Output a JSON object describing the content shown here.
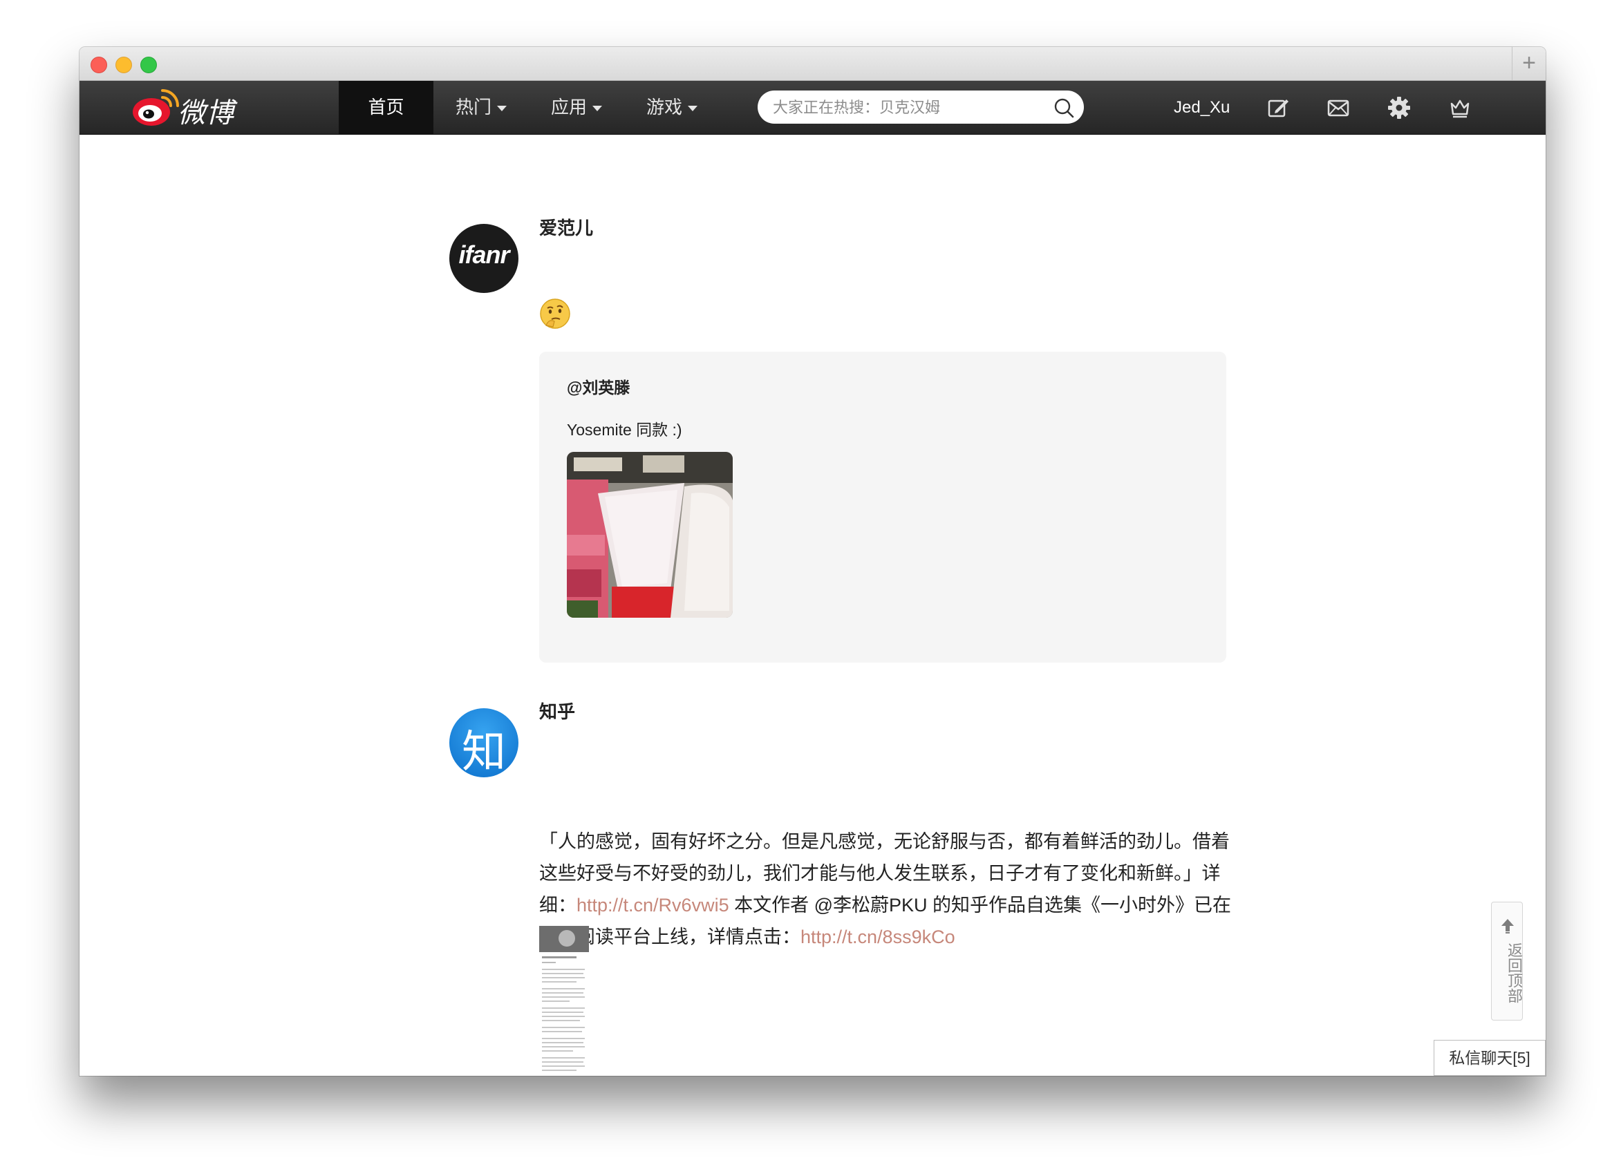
{
  "window": {
    "new_tab_icon": "plus-icon"
  },
  "navbar": {
    "logo_text": "微博",
    "items": [
      {
        "label": "首页",
        "active": true
      },
      {
        "label": "热门",
        "has_dropdown": true
      },
      {
        "label": "应用",
        "has_dropdown": true
      },
      {
        "label": "游戏",
        "has_dropdown": true
      }
    ],
    "search_placeholder": "大家正在热搜：贝克汉姆",
    "username": "Jed_Xu",
    "icons": [
      "compose-icon",
      "mail-icon",
      "gear-icon",
      "crown-icon"
    ]
  },
  "posts": [
    {
      "author": "爱范儿",
      "avatar_text": "ifanr",
      "emoji": "thinking-face-icon",
      "repost": {
        "user": "@刘英滕",
        "text": "Yosemite 同款 :)"
      }
    },
    {
      "author": "知乎",
      "avatar_text": "知",
      "text_parts": [
        "「人的感觉，固有好坏之分。但是凡感觉，无论舒服与否，都有着鲜活的劲儿。借着这些好受与不好受的劲儿，我们才能与他人发生联系，日子才有了变化和新鲜。」详细：",
        "http://t.cn/Rv6vwi5",
        " 本文作者 @李松蔚PKU 的知乎作品自选集《一小时外》已在各大阅读平台上线，详情点击：",
        "http://t.cn/8ss9kCo"
      ]
    }
  ],
  "back_to_top": "返回顶部",
  "chat_button": "私信聊天[5]",
  "colors": {
    "link": "#c6877a",
    "navbar": "#2b2b2b",
    "zhihu_blue": "#1f8ae0"
  }
}
